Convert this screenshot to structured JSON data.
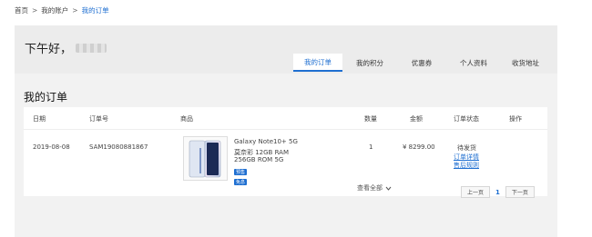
{
  "breadcrumb": {
    "home": "首页",
    "account": "我的账户",
    "current": "我的订单",
    "sep": ">"
  },
  "greeting": "下午好，",
  "tabs": [
    {
      "label": "我的订单",
      "active": true
    },
    {
      "label": "我的积分"
    },
    {
      "label": "优惠券"
    },
    {
      "label": "个人资料"
    },
    {
      "label": "收货地址"
    }
  ],
  "orders_title": "我的订单",
  "table": {
    "headers": {
      "date": "日期",
      "order_no": "订单号",
      "product": "商品",
      "qty": "数量",
      "amount": "金额",
      "status": "订单状态",
      "action": "操作"
    },
    "row": {
      "date": "2019-08-08",
      "order_no": "SAM19080881867",
      "product_name": "Galaxy Note10+ 5G",
      "product_spec1": "莫奈彩  12GB RAM",
      "product_spec2": "256GB ROM  5G",
      "badge1": "预售",
      "badge2": "免息",
      "qty": "1",
      "amount": "¥ 8299.00",
      "status": "待发货",
      "link_detail": "订单详情",
      "link_service": "售后规则"
    },
    "expand_label": "查看全部"
  },
  "pager": {
    "prev": "上一页",
    "page": "1",
    "next": "下一页"
  },
  "colors": {
    "accent": "#1f6fd1",
    "panel": "#f2f2f2"
  }
}
